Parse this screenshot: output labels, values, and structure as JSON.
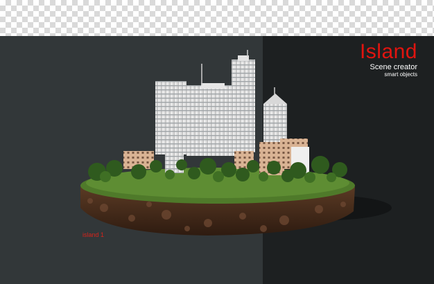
{
  "title": {
    "main": "Island",
    "subtitle": "Scene creator",
    "caption": "smart objects"
  },
  "label": "island 1",
  "colors": {
    "accent_red": "#e1140f",
    "left_panel": "#323739",
    "right_panel": "#1d2021",
    "grass": "#4f7a2a",
    "soil": "#4a2c1a"
  }
}
